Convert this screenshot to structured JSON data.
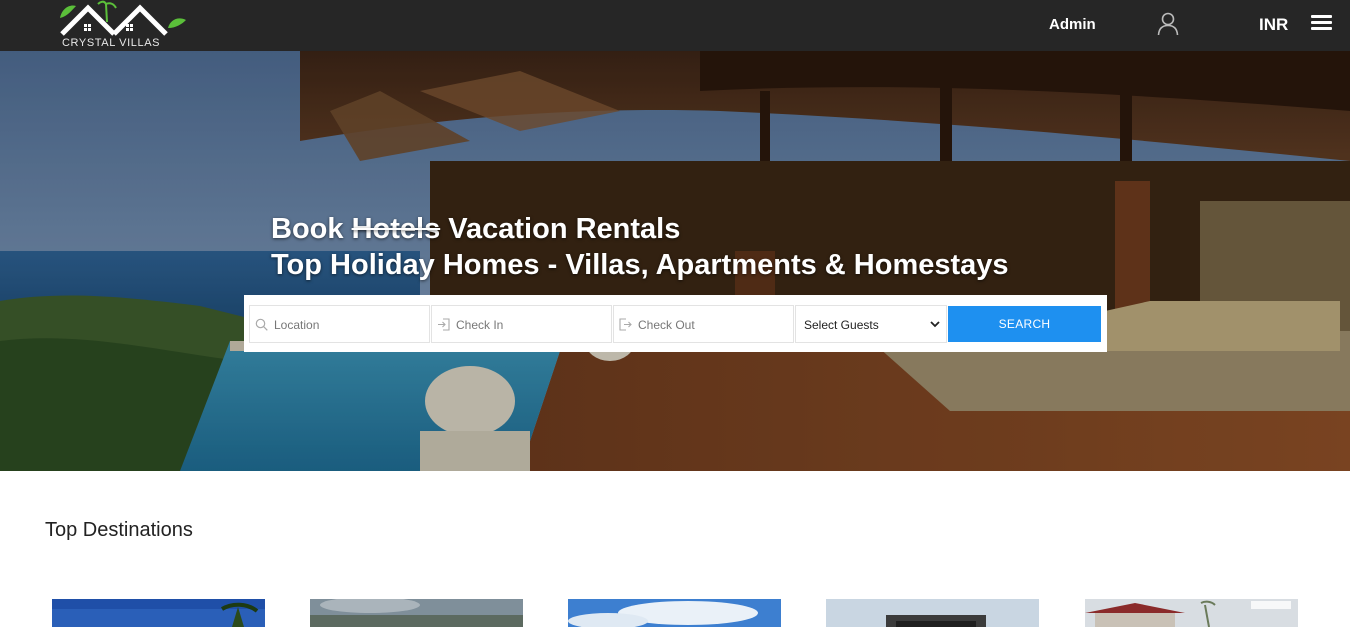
{
  "header": {
    "logo_text": "CRYSTAL VILLAS",
    "admin_label": "Admin",
    "user_icon": "user-icon",
    "currency": "INR",
    "menu_icon": "hamburger-menu-icon",
    "background": "#262626"
  },
  "hero": {
    "headline_book": "Book",
    "headline_strike": "Hotels",
    "headline_rest": "Vacation Rentals",
    "subheadline": "Top Holiday Homes - Villas, Apartments & Homestays"
  },
  "search": {
    "location_placeholder": "Location",
    "checkin_placeholder": "Check In",
    "checkout_placeholder": "Check Out",
    "guests_selected": "Select Guests",
    "button_label": "SEARCH",
    "button_color": "#1e90f0"
  },
  "destinations": {
    "title": "Top Destinations",
    "cards": 5
  }
}
